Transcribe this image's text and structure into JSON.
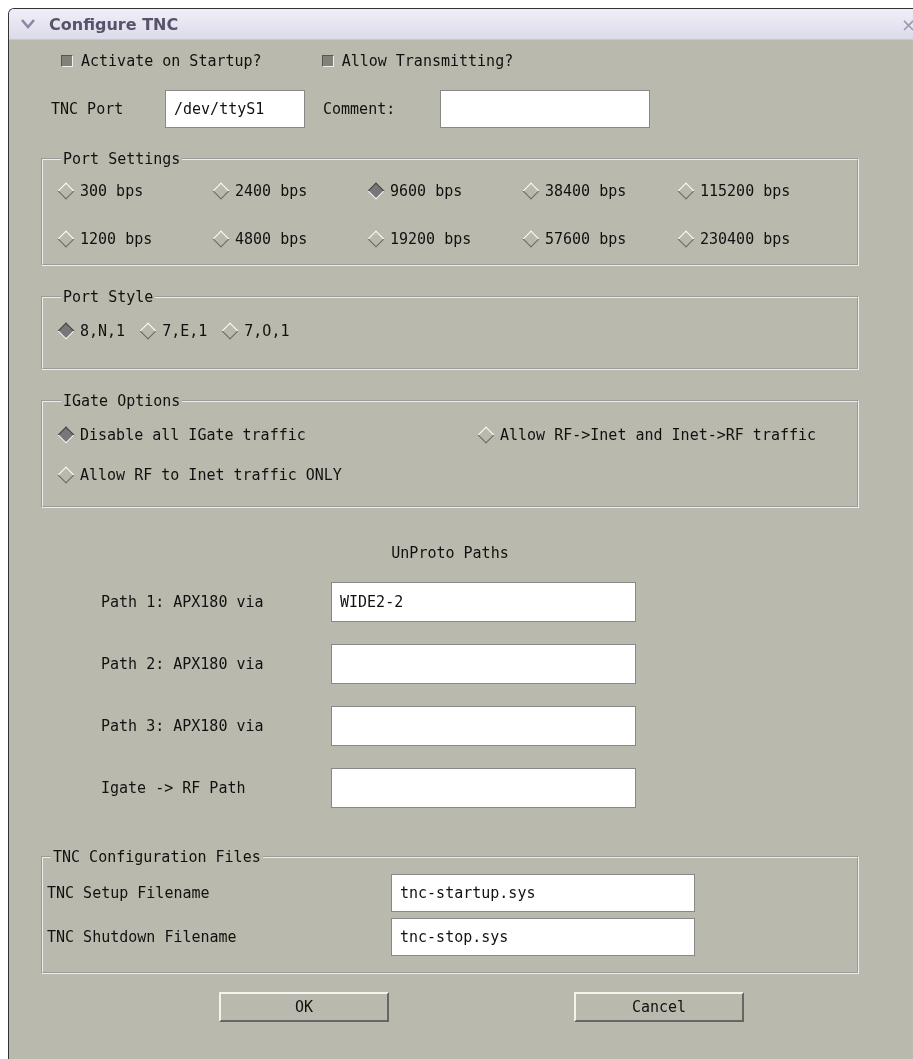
{
  "window": {
    "title": "Configure TNC",
    "close": "×"
  },
  "options": [
    {
      "label": "Activate on Startup?",
      "checked": true
    },
    {
      "label": "Allow Transmitting?",
      "checked": true
    }
  ],
  "port_row": {
    "port_label": "TNC Port",
    "port_value": "/dev/ttyS1",
    "comment_label": "Comment:"
  },
  "port_settings": {
    "title": "Port Settings",
    "rates": [
      {
        "label": "300 bps",
        "selected": false
      },
      {
        "label": "2400 bps",
        "selected": false
      },
      {
        "label": "9600 bps",
        "selected": true
      },
      {
        "label": "38400 bps",
        "selected": false
      },
      {
        "label": "115200 bps",
        "selected": false
      },
      {
        "label": "1200 bps",
        "selected": false
      },
      {
        "label": "4800 bps",
        "selected": false
      },
      {
        "label": "19200 bps",
        "selected": false
      },
      {
        "label": "57600 bps",
        "selected": false
      },
      {
        "label": "230400 bps",
        "selected": false
      }
    ]
  },
  "port_style": {
    "title": "Port Style",
    "styles": [
      {
        "label": "8,N,1",
        "selected": true
      },
      {
        "label": "7,E,1",
        "selected": false
      },
      {
        "label": "7,O,1",
        "selected": false
      }
    ]
  },
  "igate_options": {
    "title": "IGate Options",
    "choices": [
      {
        "label": "Disable all IGate traffic",
        "selected": true
      },
      {
        "label": "Allow RF->Inet and Inet->RF traffic",
        "selected": false
      },
      {
        "label": "Allow RF to Inet traffic ONLY",
        "selected": false
      }
    ]
  },
  "unproto": {
    "title": "UnProto Paths",
    "paths": [
      {
        "label": "Path 1: APX180 via",
        "value": "WIDE2-2"
      },
      {
        "label": "Path 2: APX180 via"
      },
      {
        "label": "Path 3: APX180 via"
      },
      {
        "label": "Igate -> RF Path"
      }
    ]
  },
  "config_files": {
    "title": "TNC Configuration Files",
    "files": [
      {
        "label": "TNC Setup Filename",
        "value": "tnc-startup.sys"
      },
      {
        "label": "TNC Shutdown Filename",
        "value": "tnc-stop.sys"
      }
    ]
  },
  "buttons": [
    "OK",
    "Cancel"
  ]
}
